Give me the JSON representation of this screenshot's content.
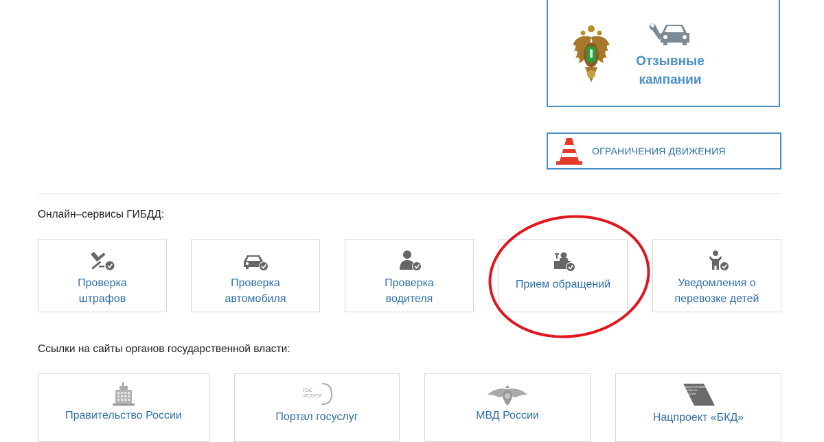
{
  "recall": {
    "title_line1": "Отзывные",
    "title_line2": "кампании"
  },
  "restrictions": {
    "label": "ОГРАНИЧЕНИЯ ДВИЖЕНИЯ",
    "icon": "traffic-cone-icon"
  },
  "online_services": {
    "heading": "Онлайн–сервисы ГИБДД:",
    "items": [
      {
        "line1": "Проверка",
        "line2": "штрафов",
        "icon": "gavel-check-icon"
      },
      {
        "line1": "Проверка",
        "line2": "автомобиля",
        "icon": "car-check-icon"
      },
      {
        "line1": "Проверка",
        "line2": "водителя",
        "icon": "person-check-icon"
      },
      {
        "line1": "Прием обращений",
        "line2": "",
        "icon": "reception-desk-icon"
      },
      {
        "line1": "Уведомления о",
        "line2": "перевозке детей",
        "icon": "child-check-icon"
      }
    ]
  },
  "gov_links": {
    "heading": "Ссылки на сайты органов государственной власти:",
    "items": [
      {
        "label": "Правительство России",
        "icon": "government-building-icon"
      },
      {
        "label": "Портал госуслуг",
        "icon": "gosuslugi-logo-icon",
        "logo_text1": "ГОС",
        "logo_text2": "УСЛУГИ"
      },
      {
        "label": "МВД России",
        "icon": "mvd-eagle-icon"
      },
      {
        "label": "Нацпроект «БКД»",
        "icon": "bkd-logo-icon",
        "logo_text1": "НАЦИОНАЛЬНЫЕ",
        "logo_text2": "ПРОЕКТЫ",
        "logo_text3": "РОССИИ"
      }
    ]
  },
  "colors": {
    "link": "#2e6ea8",
    "accent_border": "#4a8ec2",
    "annotation": "#e0161e"
  }
}
